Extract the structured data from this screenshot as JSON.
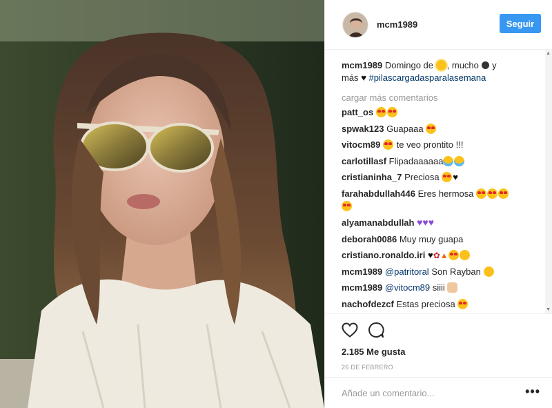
{
  "post": {
    "photo_alt": "Foto de mcm1989",
    "username": "mcm1989",
    "follow_label": "Seguir"
  },
  "caption": {
    "user": "mcm1989",
    "text_before": "Domingo de",
    "text_middle": ", mucho",
    "text_after": "y",
    "text_line2": "más",
    "hashtag": "#pilascargadasparalasemana"
  },
  "load_more_label": "cargar más comentarios",
  "comments": [
    {
      "user": "patt_os",
      "text": ""
    },
    {
      "user": "spwak123",
      "text": "Guapaaa"
    },
    {
      "user": "vitocm89",
      "text": "te veo prontito !!!"
    },
    {
      "user": "carlotillasf",
      "text": "Flipadaaaaaa"
    },
    {
      "user": "cristianinha_7",
      "text": "Preciosa"
    },
    {
      "user": "farahabdullah446",
      "text": "Eres hermosa"
    },
    {
      "user": "alyamanabdullah",
      "text": ""
    },
    {
      "user": "deborah0086",
      "text": "Muy muy guapa"
    },
    {
      "user": "cristiano.ronaldo.iri",
      "text": ""
    },
    {
      "user": "mcm1989",
      "mention": "@patritoral",
      "text": "Son Rayban"
    },
    {
      "user": "mcm1989",
      "mention": "@vitocm89",
      "text": "siiii"
    },
    {
      "user": "nachofdezcf",
      "text": "Estas preciosa"
    }
  ],
  "likes_label": "2.185 Me gusta",
  "date_label": "26 DE FEBRERO",
  "add_comment_placeholder": "Añade un comentario...",
  "more_label": "•••",
  "icons": [
    "heart-icon",
    "comment-icon",
    "more-options-icon",
    "scroll-up-arrow",
    "scroll-down-arrow"
  ],
  "colors": {
    "accent": "#3897f0",
    "text": "#262626",
    "muted": "#999999",
    "link": "#003569"
  }
}
